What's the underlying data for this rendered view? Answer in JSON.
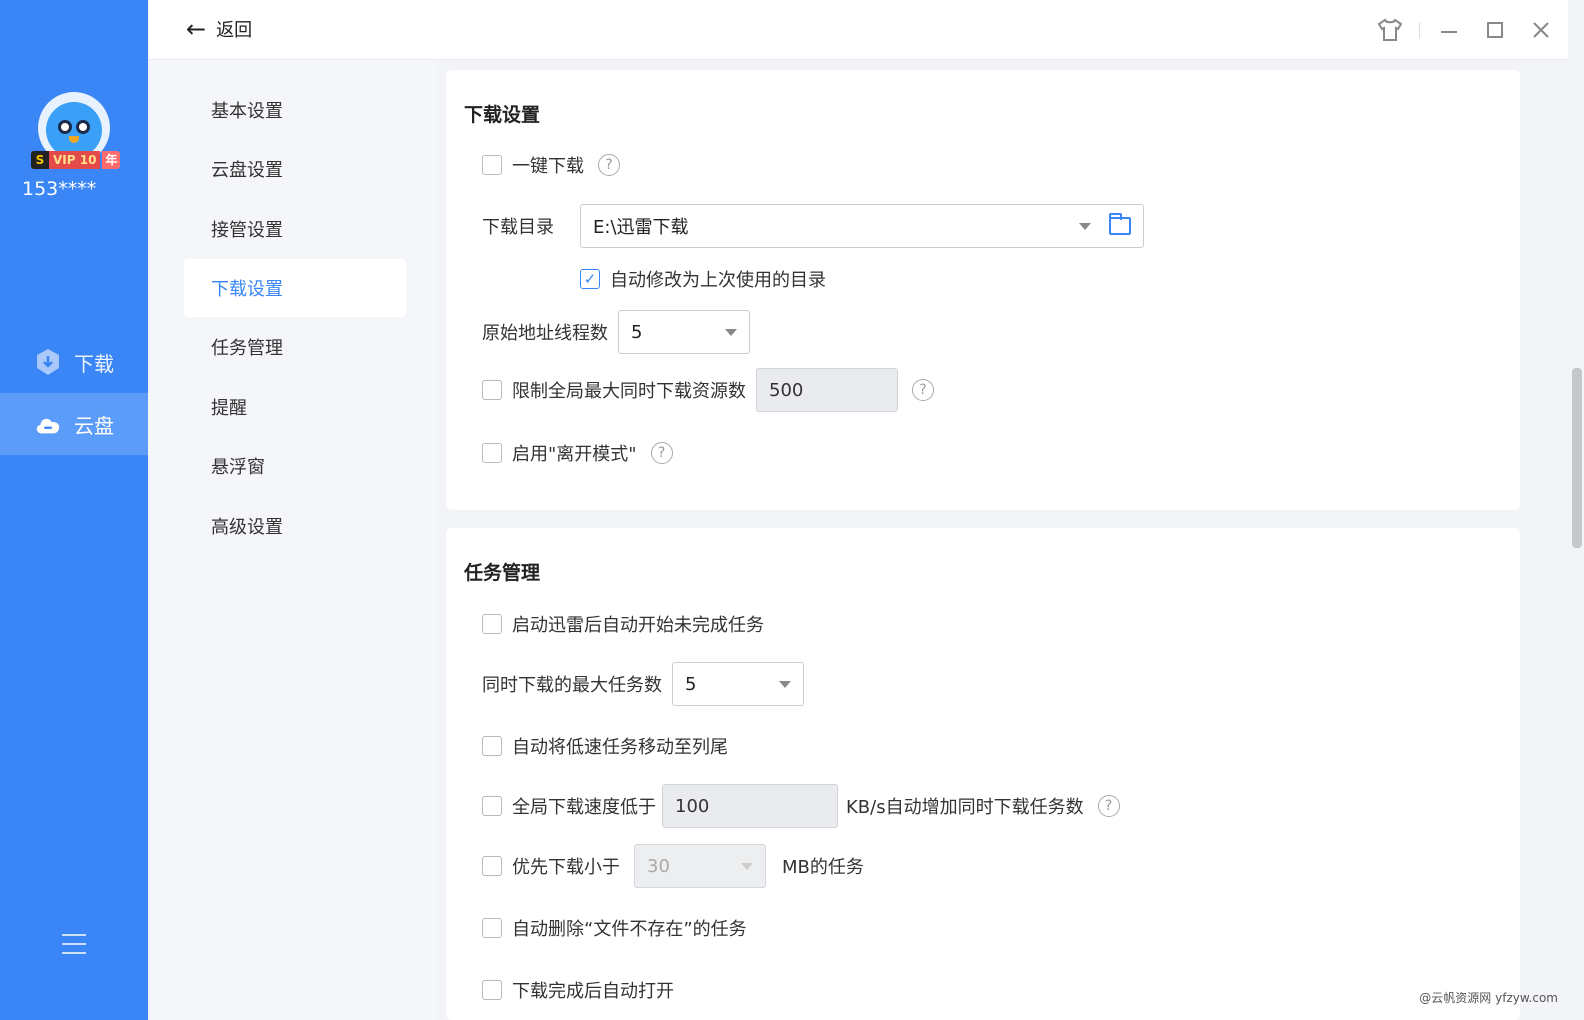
{
  "app": {
    "username": "153****",
    "vip": {
      "s": "S",
      "v": "VIP 10",
      "y": "年"
    }
  },
  "left_nav": [
    {
      "label": "下载",
      "icon": "download-shield-icon",
      "active": false
    },
    {
      "label": "云盘",
      "icon": "cloud-icon",
      "active": true
    }
  ],
  "topbar": {
    "back_label": "返回"
  },
  "settings_nav": [
    {
      "label": "基本设置",
      "active": false
    },
    {
      "label": "云盘设置",
      "active": false
    },
    {
      "label": "接管设置",
      "active": false
    },
    {
      "label": "下载设置",
      "active": true
    },
    {
      "label": "任务管理",
      "active": false
    },
    {
      "label": "提醒",
      "active": false
    },
    {
      "label": "悬浮窗",
      "active": false
    },
    {
      "label": "高级设置",
      "active": false
    }
  ],
  "download": {
    "title": "下载设置",
    "one_click": "一键下载",
    "dir_label": "下载目录",
    "dir_value": "E:\\迅雷下载",
    "auto_last_dir": "自动修改为上次使用的目录",
    "threads_label": "原始地址线程数",
    "threads_value": "5",
    "limit_label": "限制全局最大同时下载资源数",
    "limit_value": "500",
    "away_mode": "启用\"离开模式\""
  },
  "tasks": {
    "title": "任务管理",
    "auto_start": "启动迅雷后自动开始未完成任务",
    "max_tasks_label": "同时下载的最大任务数",
    "max_tasks_value": "5",
    "move_slow": "自动将低速任务移动至列尾",
    "speed_label": "全局下载速度低于",
    "speed_value": "100",
    "speed_suffix": "KB/s自动增加同时下载任务数",
    "small_label": "优先下载小于",
    "small_value": "30",
    "small_suffix": "MB的任务",
    "auto_delete": "自动删除“文件不存在”的任务",
    "auto_open": "下载完成后自动打开"
  },
  "footer": "@云帆资源网 yfzyw.com"
}
